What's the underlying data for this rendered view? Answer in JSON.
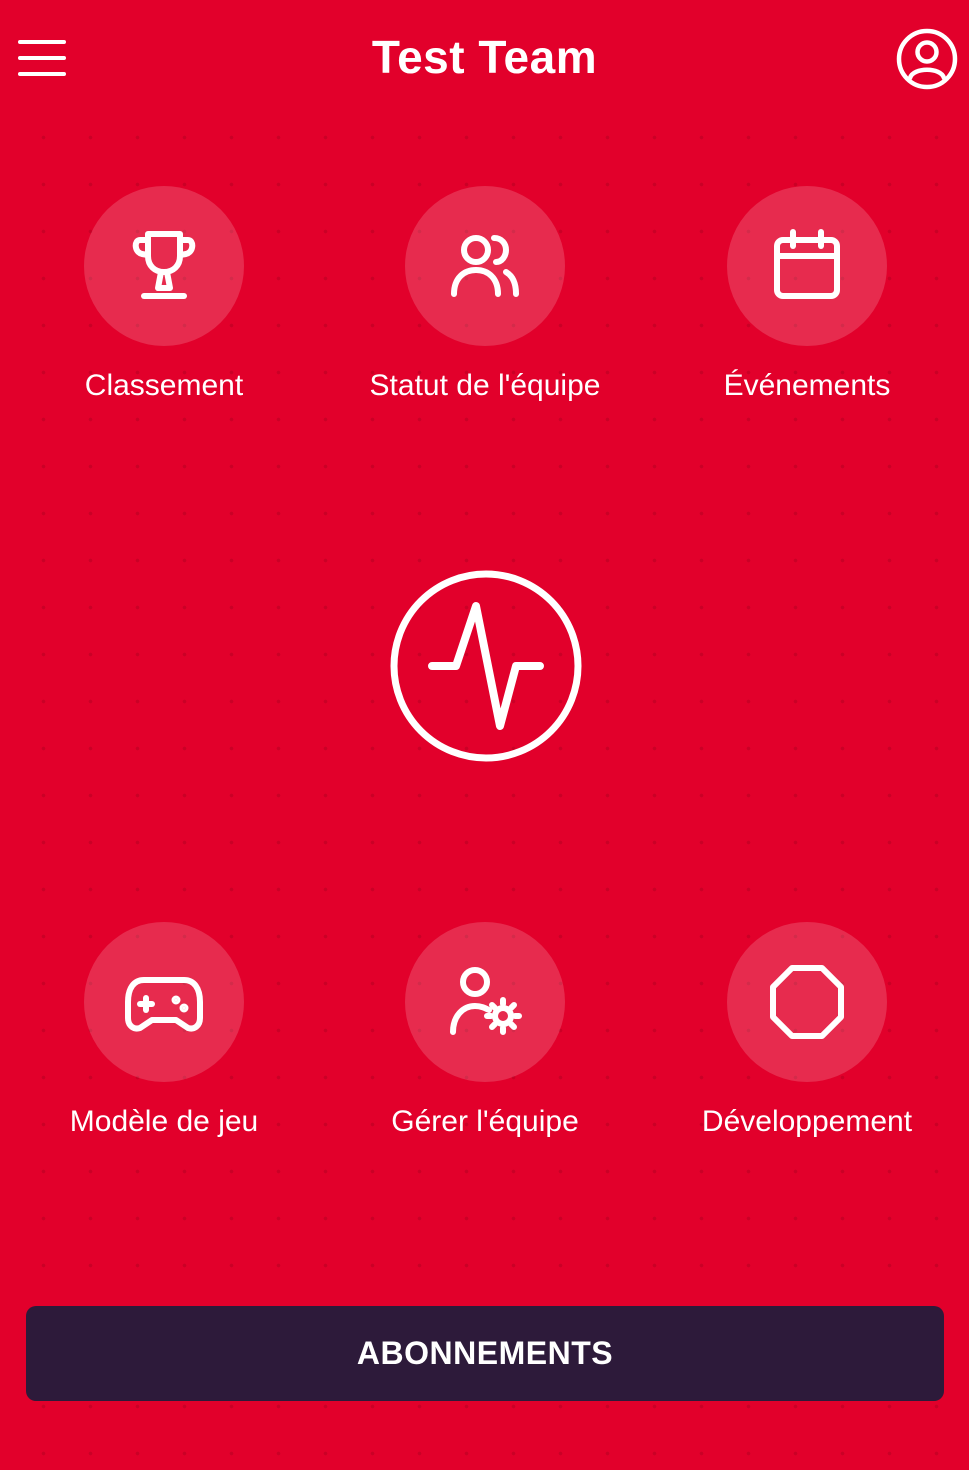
{
  "header": {
    "title": "Test Team",
    "menu_icon": "hamburger-menu-icon",
    "profile_icon": "user-circle-icon"
  },
  "tiles_top": [
    {
      "label": "Classement",
      "icon": "trophy-icon"
    },
    {
      "label": "Statut de l'équipe",
      "icon": "users-icon"
    },
    {
      "label": "Événements",
      "icon": "calendar-icon"
    }
  ],
  "center": {
    "icon": "activity-pulse-icon"
  },
  "tiles_bottom": [
    {
      "label": "Modèle de jeu",
      "icon": "gamepad-icon"
    },
    {
      "label": "Gérer l'équipe",
      "icon": "user-settings-icon"
    },
    {
      "label": "Développement",
      "icon": "octagon-icon"
    }
  ],
  "subscribe": {
    "label": "ABONNEMENTS"
  },
  "colors": {
    "background": "#e2002b",
    "button": "#2d1a3a",
    "foreground": "#ffffff"
  }
}
